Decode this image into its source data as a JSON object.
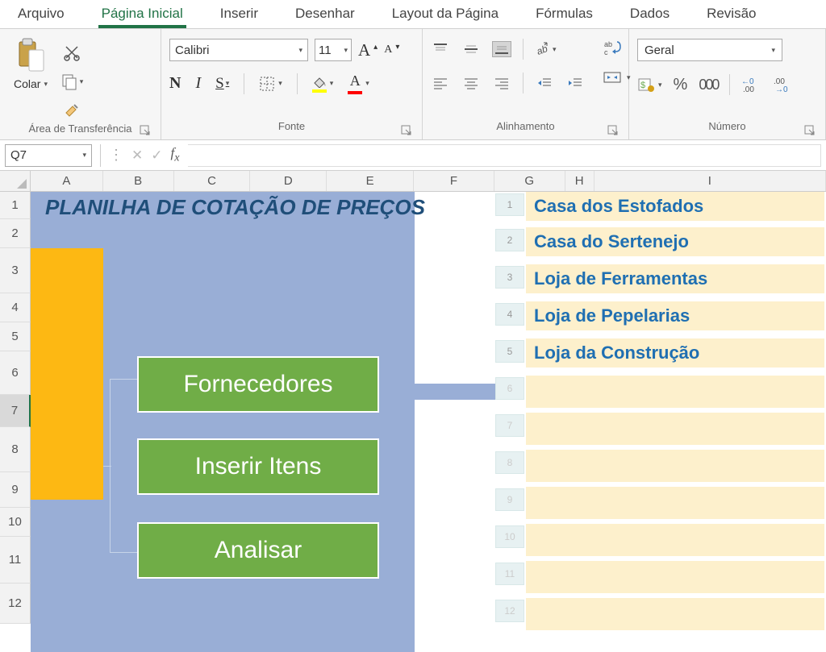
{
  "tabs": [
    "Arquivo",
    "Página Inicial",
    "Inserir",
    "Desenhar",
    "Layout da Página",
    "Fórmulas",
    "Dados",
    "Revisão"
  ],
  "active_tab_index": 1,
  "clipboard": {
    "paste_label": "Colar",
    "group_label": "Área de Transferência"
  },
  "font": {
    "name": "Calibri",
    "size": "11",
    "bold": "N",
    "italic": "I",
    "underline": "S",
    "group_label": "Fonte"
  },
  "alignment": {
    "group_label": "Alinhamento"
  },
  "number": {
    "format": "Geral",
    "group_label": "Número"
  },
  "name_box": "Q7",
  "sheet": {
    "columns": [
      "A",
      "B",
      "C",
      "D",
      "E",
      "F",
      "G",
      "H",
      "I"
    ],
    "rows": [
      "1",
      "2",
      "3",
      "4",
      "5",
      "6",
      "7",
      "8",
      "9",
      "10",
      "11",
      "12"
    ],
    "selected_row": 7,
    "title": "PLANILHA DE COTAÇÃO DE PREÇOS",
    "buttons": [
      "Fornecedores",
      "Inserir Itens",
      "Analisar"
    ],
    "h_numbers": [
      "1",
      "2",
      "3",
      "4",
      "5",
      "6",
      "7",
      "8",
      "9",
      "10",
      "11",
      "12"
    ],
    "suppliers": [
      "Casa dos Estofados",
      "Casa do Sertenejo",
      "Loja de Ferramentas",
      "Loja de Pepelarias",
      "Loja da Construção"
    ]
  }
}
